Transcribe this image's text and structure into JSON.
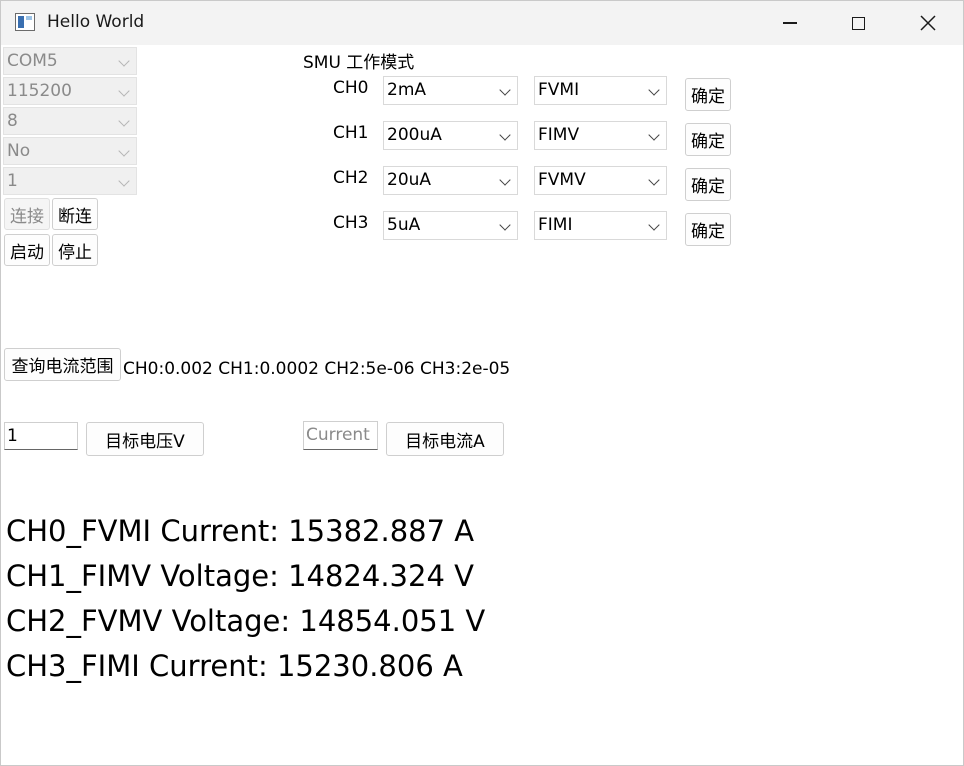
{
  "window": {
    "title": "Hello World"
  },
  "serial": {
    "port": "COM5",
    "baud": "115200",
    "data_bits": "8",
    "parity": "No",
    "stop_bits": "1",
    "connect_label": "连接",
    "disconnect_label": "断连",
    "start_label": "启动",
    "stop_label": "停止"
  },
  "smu": {
    "heading": "SMU 工作模式",
    "channels": [
      {
        "name": "CH0",
        "range": "2mA",
        "mode": "FVMI",
        "confirm": "确定"
      },
      {
        "name": "CH1",
        "range": "200uA",
        "mode": "FIMV",
        "confirm": "确定"
      },
      {
        "name": "CH2",
        "range": "20uA",
        "mode": "FVMV",
        "confirm": "确定"
      },
      {
        "name": "CH3",
        "range": "5uA",
        "mode": "FIMI",
        "confirm": "确定"
      }
    ]
  },
  "query": {
    "button_label": "查询电流范围",
    "result": "CH0:0.002 CH1:0.0002 CH2:5e-06 CH3:2e-05"
  },
  "targets": {
    "voltage_value": "1",
    "voltage_button": "目标电压V",
    "current_placeholder": "Current",
    "current_button": "目标电流A"
  },
  "readings": [
    "CH0_FVMI Current: 15382.887 A",
    "CH1_FIMV Voltage: 14824.324 V",
    "CH2_FVMV Voltage: 14854.051 V",
    "CH3_FIMI Current: 15230.806 A"
  ]
}
